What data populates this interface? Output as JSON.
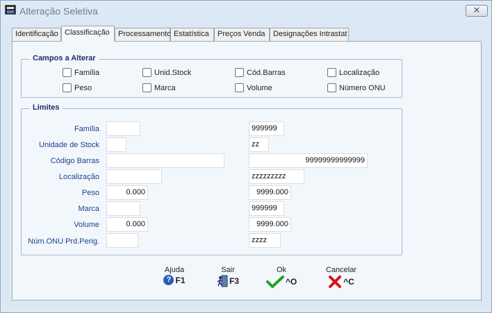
{
  "window": {
    "title": "Alteração Seletiva",
    "close_glyph": "✕"
  },
  "tabs": [
    {
      "label": "Identificação"
    },
    {
      "label": "Classificação"
    },
    {
      "label": "Processamento"
    },
    {
      "label": "Estatística"
    },
    {
      "label": "Preços Venda"
    },
    {
      "label": "Designações Intrastat"
    }
  ],
  "campos": {
    "title": "Campos a Alterar",
    "items": [
      {
        "label": "Família",
        "checked": false
      },
      {
        "label": "Unid.Stock",
        "checked": false
      },
      {
        "label": "Cód.Barras",
        "checked": false
      },
      {
        "label": "Localização",
        "checked": false
      },
      {
        "label": "Peso",
        "checked": false
      },
      {
        "label": "Marca",
        "checked": false
      },
      {
        "label": "Volume",
        "checked": false
      },
      {
        "label": "Número ONU",
        "checked": false
      }
    ]
  },
  "limites": {
    "title": "Limites",
    "rows": [
      {
        "label": "Família",
        "from": "",
        "to": "999999"
      },
      {
        "label": "Unidade de Stock",
        "from": "",
        "to": "zz"
      },
      {
        "label": "Código Barras",
        "from": "",
        "to": "99999999999999"
      },
      {
        "label": "Localização",
        "from": "",
        "to": "zzzzzzzzz"
      },
      {
        "label": "Peso",
        "from": "0.000",
        "to": "9999.000"
      },
      {
        "label": "Marca",
        "from": "",
        "to": "999999"
      },
      {
        "label": "Volume",
        "from": "0.000",
        "to": "9999.000"
      },
      {
        "label": "Núm.ONU Prd.Perig.",
        "from": "",
        "to": "zzzz"
      }
    ]
  },
  "buttons": {
    "help": {
      "caption": "Ajuda",
      "key": "F1",
      "icon": "help-icon"
    },
    "exit": {
      "caption": "Sair",
      "key": "F3",
      "icon": "exit-door-icon"
    },
    "ok": {
      "caption": "Ok",
      "key": "^O",
      "icon": "checkmark-icon"
    },
    "cancel": {
      "caption": "Cancelar",
      "key": "^C",
      "icon": "cancel-x-icon"
    }
  },
  "colors": {
    "accent": "#1b2f6b",
    "label": "#1e3f8f",
    "ok": "#1fa51f",
    "cancel": "#d61414"
  }
}
